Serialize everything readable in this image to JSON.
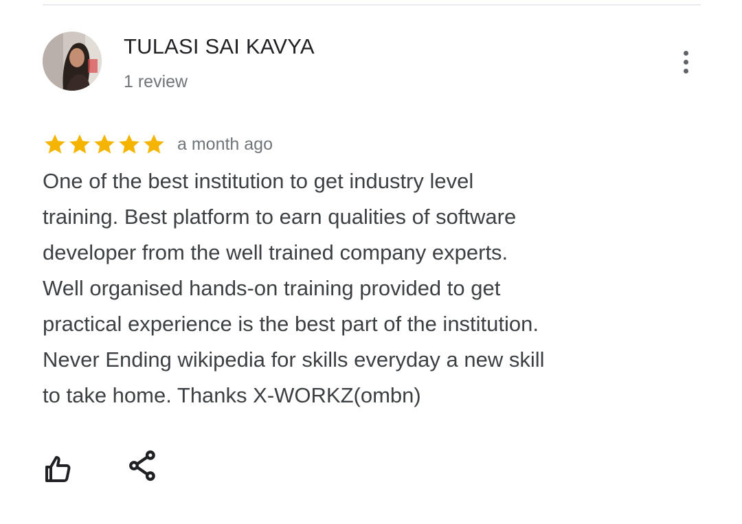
{
  "review": {
    "author_name": "TULASI SAI KAVYA",
    "author_review_count": "1 review",
    "rating": 5,
    "rating_max": 5,
    "time_ago": "a month ago",
    "text": "One of the best institution to get industry level\ntraining. Best platform to earn qualities of software\ndeveloper from the well trained company experts.\nWell organised hands-on training provided to get\npractical experience is the best part of the institution.\nNever Ending wikipedia for skills everyday a new skill\nto take home. Thanks X-WORKZ(ombn)"
  },
  "icons": {
    "more": "more-vertical-icon",
    "star": "star-icon",
    "like": "thumbs-up-icon",
    "share": "share-icon"
  },
  "colors": {
    "star": "#f4b400",
    "name": "#202124",
    "body_text": "#3c4043",
    "secondary_text": "#70757a",
    "icon": "#5f6368",
    "divider": "#e8eaed"
  }
}
